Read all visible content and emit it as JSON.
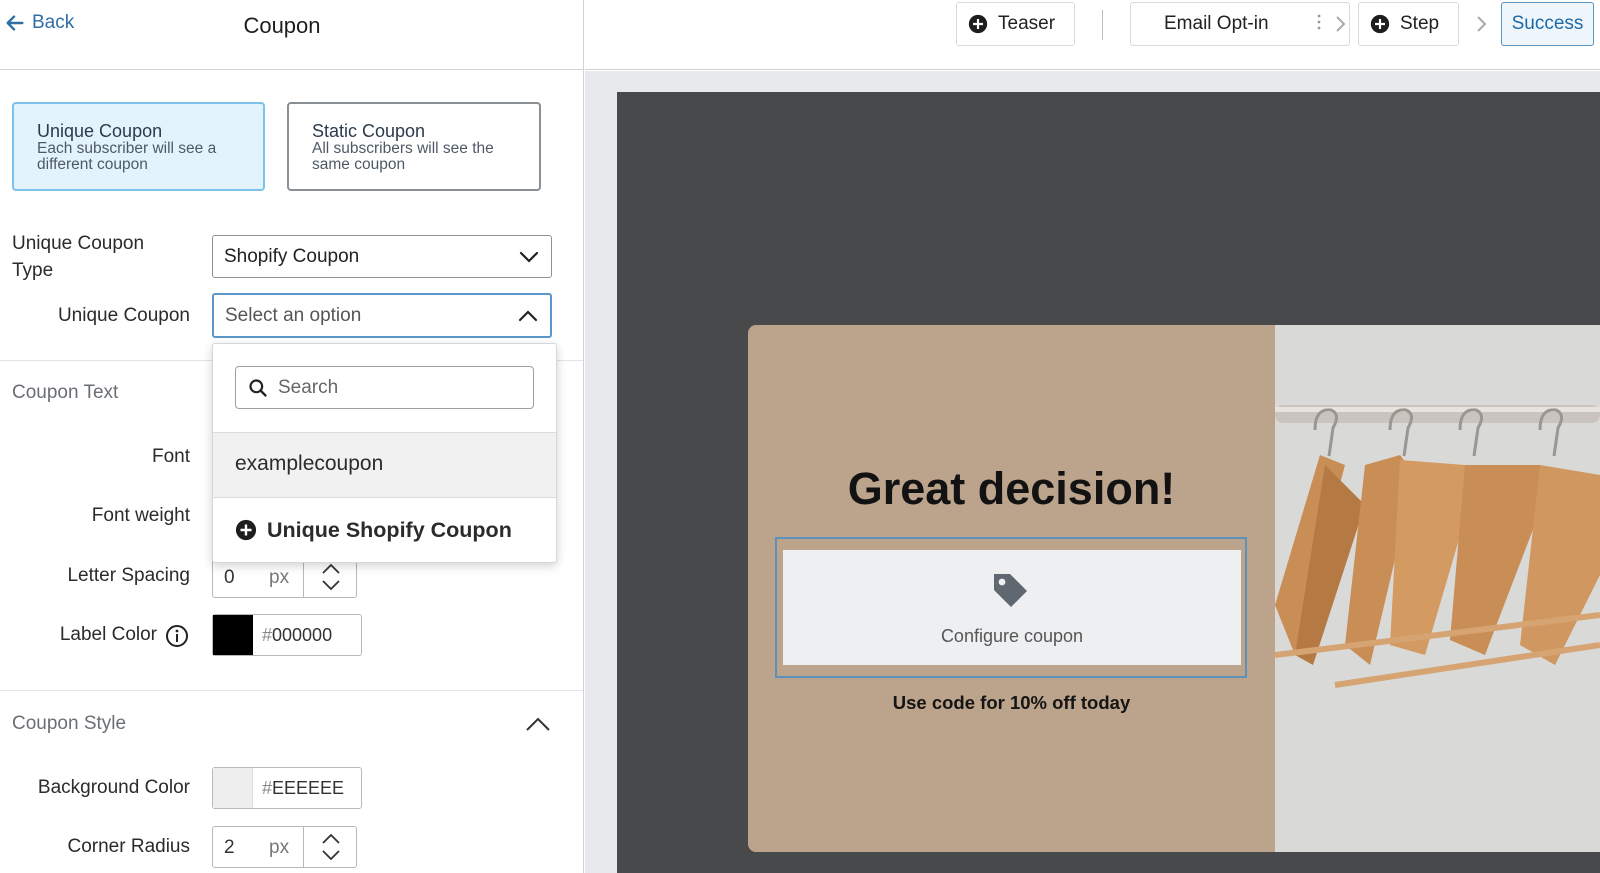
{
  "left_panel": {
    "back_label": "Back",
    "title": "Coupon",
    "coupon_types": [
      {
        "title": "Unique Coupon",
        "desc": "Each subscriber will see a different coupon",
        "selected": true
      },
      {
        "title": "Static Coupon",
        "desc": "All subscribers will see the same coupon",
        "selected": false
      }
    ],
    "unique_coupon_type": {
      "label": "Unique Coupon Type",
      "value": "Shopify Coupon"
    },
    "unique_coupon": {
      "label": "Unique Coupon",
      "placeholder": "Select an option"
    },
    "dropdown": {
      "search_placeholder": "Search",
      "options": [
        "examplecoupon"
      ],
      "create_label": "Unique Shopify Coupon"
    },
    "coupon_text": {
      "section_label": "Coupon Text",
      "font_label": "Font",
      "font_weight_label": "Font weight",
      "letter_spacing": {
        "label": "Letter Spacing",
        "value": "0",
        "unit": "px"
      },
      "label_color": {
        "label": "Label Color",
        "hash": "#",
        "value": "000000",
        "swatch": "#000000"
      }
    },
    "coupon_style": {
      "section_label": "Coupon Style",
      "background_color": {
        "label": "Background Color",
        "hash": "#",
        "value": "EEEEEE",
        "swatch": "#EEEEEE"
      },
      "corner_radius": {
        "label": "Corner Radius",
        "value": "2",
        "unit": "px"
      }
    }
  },
  "topbar": {
    "teaser": "Teaser",
    "email_optin": "Email Opt-in",
    "step": "Step",
    "success": "Success"
  },
  "preview": {
    "headline": "Great decision!",
    "coupon_placeholder": "Configure coupon",
    "subtext": "Use code for 10% off today",
    "colors": {
      "popup_bg": "#BCA38B",
      "stage_bg": "#48494B",
      "accent": "#2E6EA6"
    }
  }
}
